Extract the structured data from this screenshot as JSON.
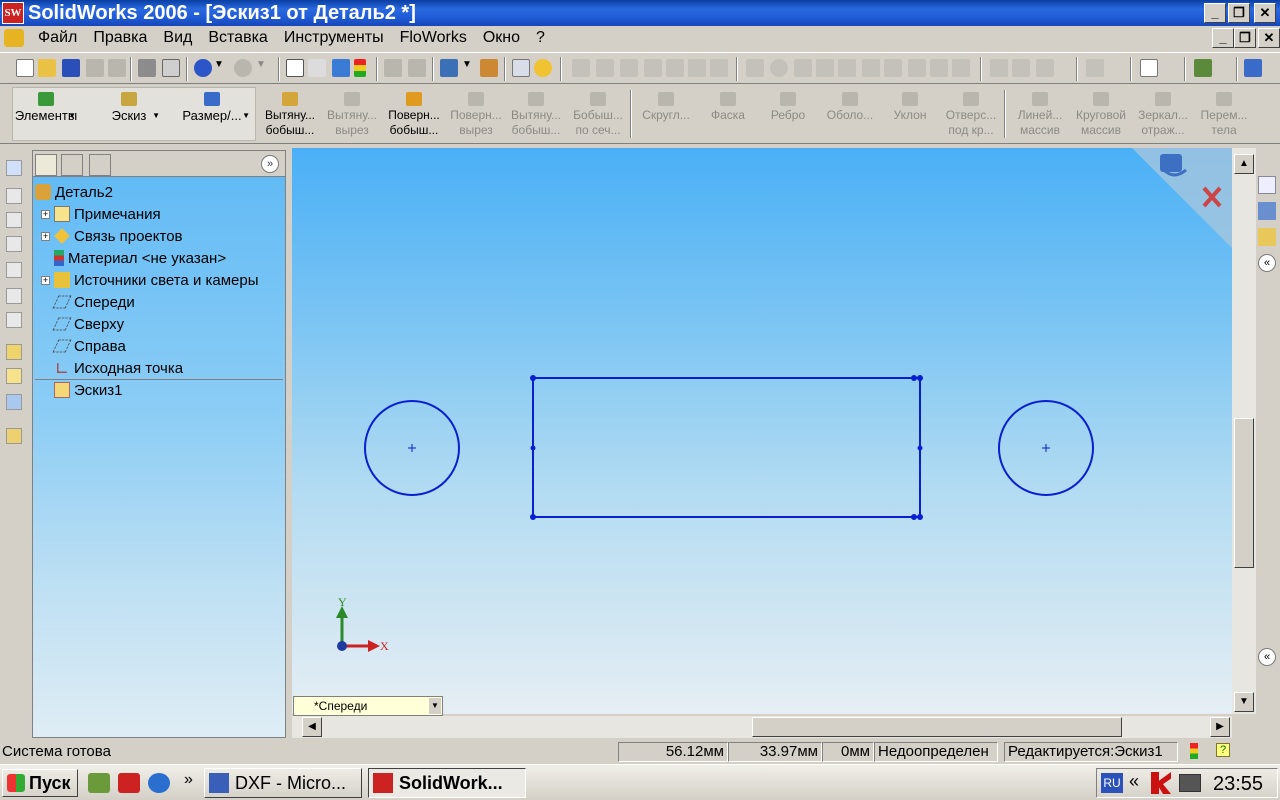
{
  "window": {
    "title": "SolidWorks 2006 - [Эскиз1 от Деталь2 *]",
    "logo_text": "SW"
  },
  "menu": {
    "items": [
      "Файл",
      "Правка",
      "Вид",
      "Вставка",
      "Инструменты",
      "FloWorks",
      "Окно",
      "?"
    ]
  },
  "command_manager": {
    "buttons": [
      {
        "line1": "Элементы",
        "line2": ""
      },
      {
        "line1": "Эскиз",
        "line2": ""
      },
      {
        "line1": "Размер/...",
        "line2": ""
      },
      {
        "line1": "Вытяну...",
        "line2": "бобыш..."
      },
      {
        "line1": "Вытяну...",
        "line2": "вырез"
      },
      {
        "line1": "Поверн...",
        "line2": "бобыш..."
      },
      {
        "line1": "Поверн...",
        "line2": "вырез"
      },
      {
        "line1": "Вытяну...",
        "line2": "бобыш..."
      },
      {
        "line1": "Бобыш...",
        "line2": "по сеч..."
      },
      {
        "line1": "Скругл...",
        "line2": ""
      },
      {
        "line1": "Фаска",
        "line2": ""
      },
      {
        "line1": "Ребро",
        "line2": ""
      },
      {
        "line1": "Оболо...",
        "line2": ""
      },
      {
        "line1": "Уклон",
        "line2": ""
      },
      {
        "line1": "Отверс...",
        "line2": "под кр..."
      },
      {
        "line1": "Линей...",
        "line2": "массив"
      },
      {
        "line1": "Круговой",
        "line2": "массив"
      },
      {
        "line1": "Зеркал...",
        "line2": "отраж..."
      },
      {
        "line1": "Перем...",
        "line2": "тела"
      }
    ]
  },
  "feature_tree": {
    "root": "Деталь2",
    "items": [
      {
        "label": "Примечания",
        "expandable": true
      },
      {
        "label": "Связь проектов",
        "expandable": true
      },
      {
        "label": "Материал <не указан>",
        "expandable": false
      },
      {
        "label": "Источники света и камеры",
        "expandable": true
      },
      {
        "label": "Спереди",
        "expandable": false
      },
      {
        "label": "Сверху",
        "expandable": false
      },
      {
        "label": "Справа",
        "expandable": false
      },
      {
        "label": "Исходная точка",
        "expandable": false
      }
    ],
    "sketch": "Эскиз1"
  },
  "viewport": {
    "view_name": "*Спереди",
    "axis_x": "X",
    "axis_y": "Y",
    "sketch_color": "#0a1fd0"
  },
  "status": {
    "message": "Система готова",
    "x": "56.12мм",
    "y": "33.97мм",
    "z": "0мм",
    "state": "Недоопределен",
    "editing": "Редактируется:Эскиз1",
    "help": "?"
  },
  "taskbar": {
    "start": "Пуск",
    "tasks": [
      "DXF - Micro...",
      "SolidWork..."
    ],
    "lang": "RU",
    "clock": "23:55"
  }
}
